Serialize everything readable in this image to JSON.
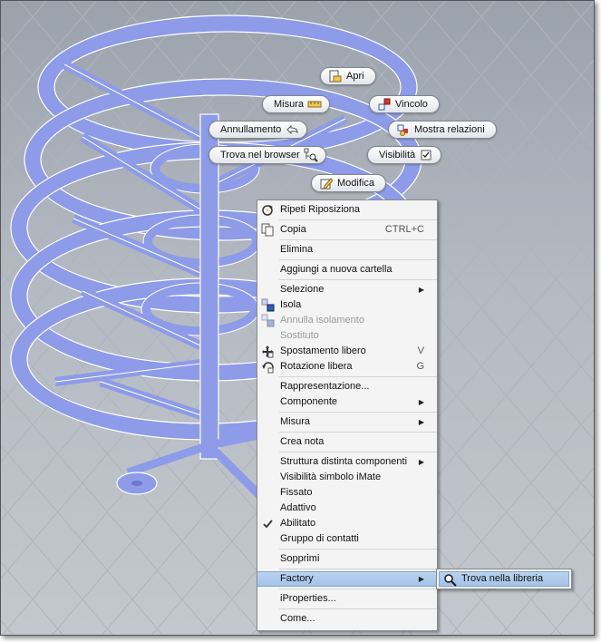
{
  "marking_menu": [
    {
      "id": "apri",
      "label": "Apri",
      "icon": "open-file-icon"
    },
    {
      "id": "misura",
      "label": "Misura",
      "icon": "ruler-icon"
    },
    {
      "id": "vincolo",
      "label": "Vincolo",
      "icon": "constraint-icon"
    },
    {
      "id": "annullamento",
      "label": "Annullamento",
      "icon": "undo-icon"
    },
    {
      "id": "mostra-relazioni",
      "label": "Mostra relazioni",
      "icon": "relations-icon"
    },
    {
      "id": "trova-browser",
      "label": "Trova nel browser",
      "icon": "browser-find-icon"
    },
    {
      "id": "visibilita",
      "label": "Visibilità",
      "icon": "checkbox-icon"
    },
    {
      "id": "modifica",
      "label": "Modifica",
      "icon": "edit-pencil-icon"
    }
  ],
  "context_menu": {
    "items": [
      {
        "label": "Ripeti Riposiziona",
        "icon": "repeat-icon"
      },
      {
        "sep": true
      },
      {
        "label": "Copia",
        "shortcut": "CTRL+C",
        "icon": "copy-icon"
      },
      {
        "sep": true
      },
      {
        "label": "Elimina"
      },
      {
        "sep": true
      },
      {
        "label": "Aggiungi a nuova cartella"
      },
      {
        "sep": true
      },
      {
        "label": "Selezione",
        "submenu": true
      },
      {
        "label": "Isola",
        "icon": "isolate-icon"
      },
      {
        "label": "Annulla isolamento",
        "disabled": true,
        "icon": "undo-isolate-icon"
      },
      {
        "label": "Sostituto",
        "disabled": true
      },
      {
        "label": "Spostamento libero",
        "shortcut": "V",
        "icon": "free-move-icon"
      },
      {
        "label": "Rotazione libera",
        "shortcut": "G",
        "icon": "free-rotate-icon"
      },
      {
        "sep": true
      },
      {
        "label": "Rappresentazione..."
      },
      {
        "label": "Componente",
        "submenu": true
      },
      {
        "sep": true
      },
      {
        "label": "Misura",
        "submenu": true
      },
      {
        "sep": true
      },
      {
        "label": "Crea nota"
      },
      {
        "sep": true
      },
      {
        "label": "Struttura distinta componenti",
        "submenu": true
      },
      {
        "label": "Visibilità simbolo iMate"
      },
      {
        "label": "Fissato"
      },
      {
        "label": "Adattivo"
      },
      {
        "label": "Abilitato",
        "checked": true,
        "icon": "checkmark-icon"
      },
      {
        "label": "Gruppo di contatti"
      },
      {
        "sep": true
      },
      {
        "label": "Sopprimi"
      },
      {
        "sep": true
      },
      {
        "label": "Factory",
        "submenu": true,
        "highlighted": true
      },
      {
        "sep": true
      },
      {
        "label": "iProperties..."
      },
      {
        "sep": true
      },
      {
        "label": "Come..."
      }
    ]
  },
  "submenu": {
    "label": "Trova nella libreria",
    "icon": "magnifier-icon"
  },
  "colors": {
    "model": "#8d9be8",
    "model_edge": "#ffffff",
    "highlight": "#a9c6ea"
  }
}
